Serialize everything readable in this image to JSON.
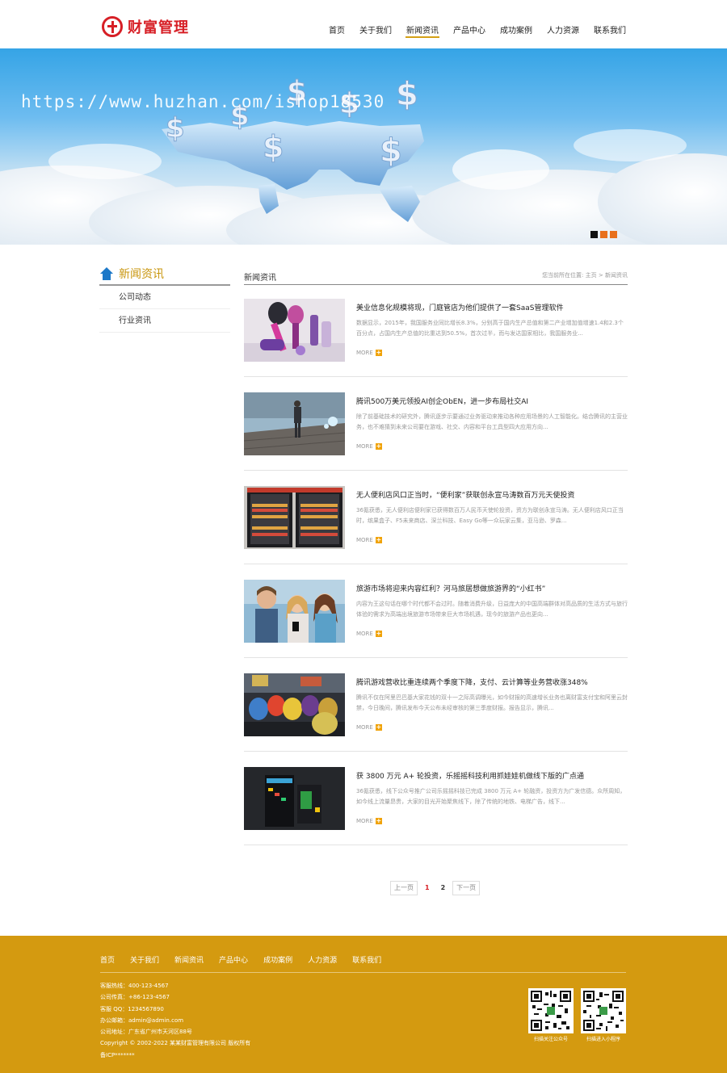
{
  "header": {
    "logo_text": "财富管理",
    "nav": [
      "首页",
      "关于我们",
      "新闻资讯",
      "产品中心",
      "成功案例",
      "人力资源",
      "联系我们"
    ]
  },
  "banner": {
    "watermark": "https://www.huzhan.com/ishop18530"
  },
  "sidebar": {
    "title": "新闻资讯",
    "items": [
      "公司动态",
      "行业资讯"
    ]
  },
  "main": {
    "title": "新闻资讯",
    "breadcrumb_prefix": "您当前所在位置:",
    "breadcrumb_home": "主页",
    "breadcrumb_sep": ">",
    "breadcrumb_current": "新闻资讯",
    "more_label": "MORE",
    "news": [
      {
        "title": "美业信息化规模将现，门庭管店为他们提供了一套SaaS管理软件",
        "desc": "数据显示，2015年，我国服务业同比增长8.3%，分别高于国内生产总值和第二产业增加值增速1.4和2.3个百分点，占国内生产总值的比重达到50.5%，首次过半，而与发达国家相比，我国服务业..."
      },
      {
        "title": "腾讯500万美元领投AI创企ObEN，进一步布局社交AI",
        "desc": "除了前基础技术的研究外，腾讯逐步示要通过业务驱动来推动各种应用场景的人工智能化。结合腾讯的主营业务，也不难猜到未来公司要在游戏、社交、内容和平台工具型四大应用方向..."
      },
      {
        "title": "无人便利店风口正当时，“便利家”获联创永宣马涛数百万元天使投资",
        "desc": "36氪获悉，无人便利店便利家已获得数百万人民币天使轮投资，资方为联创永宣马涛。无人便利店风口正当时，缤果盒子、F5未来商店、深兰科技、Easy Go等一众玩家云集，亚马逊、罗森..."
      },
      {
        "title": "旅游市场将迎来内容红利？河马旅居想做旅游界的“小红书”",
        "desc": "内容为王这句话在哪个时代都不会过时。随着消费升级，日益庞大的中国高端群体对高品质的生活方式与旅行体验的需求为高端出境旅游市场带来巨大市场机遇，现今的旅游产品也更向..."
      },
      {
        "title": "腾讯游戏营收比重连续两个季度下降，支付、云计算等业务营收涨348%",
        "desc": "腾讯不仅在阿里巴巴基大家花钱的双十一之际高调曝光，如今财报的高速增长业务也离财富支付宝和阿里云封禁，今日晚间，腾讯发布今天公布未经审核的第三季度财报。报告显示，腾讯..."
      },
      {
        "title": "获 3800 万元 A+ 轮投资，乐摇摇科技利用抓娃娃机做线下版的广点通",
        "desc": "36氪获悉，线下公众号推广公司乐摇摇科技已完成 3800 万元 A+ 轮融资，投资方为广发信德。众所周知，如今线上流量昂贵，大家的目光开始聚焦线下，除了传统的地铁、电梯广告，线下..."
      }
    ]
  },
  "pagination": {
    "prev": "上一页",
    "pages": [
      "1",
      "2"
    ],
    "next": "下一页"
  },
  "footer": {
    "nav": [
      "首页",
      "关于我们",
      "新闻资讯",
      "产品中心",
      "成功案例",
      "人力资源",
      "联系我们"
    ],
    "info": [
      "客服热线：400-123-4567",
      "公司传真：+86-123-4567",
      "客服 QQ：1234567890",
      "办公邮箱：admin@admin.com",
      "公司地址：广东省广州市天河区88号",
      "Copyright © 2002-2022 某某财富管理有限公司 版权所有",
      "备ICP*******"
    ],
    "qr_labels": [
      "扫描关注公众号",
      "扫描进入小程序"
    ]
  },
  "colors": {
    "accent": "#d4a017",
    "brand_red": "#d71f26",
    "footer_bg": "#d49a10",
    "banner_dot": "#e8701c"
  },
  "icons": [
    "home-icon",
    "plus-icon",
    "qr-code-icon"
  ]
}
